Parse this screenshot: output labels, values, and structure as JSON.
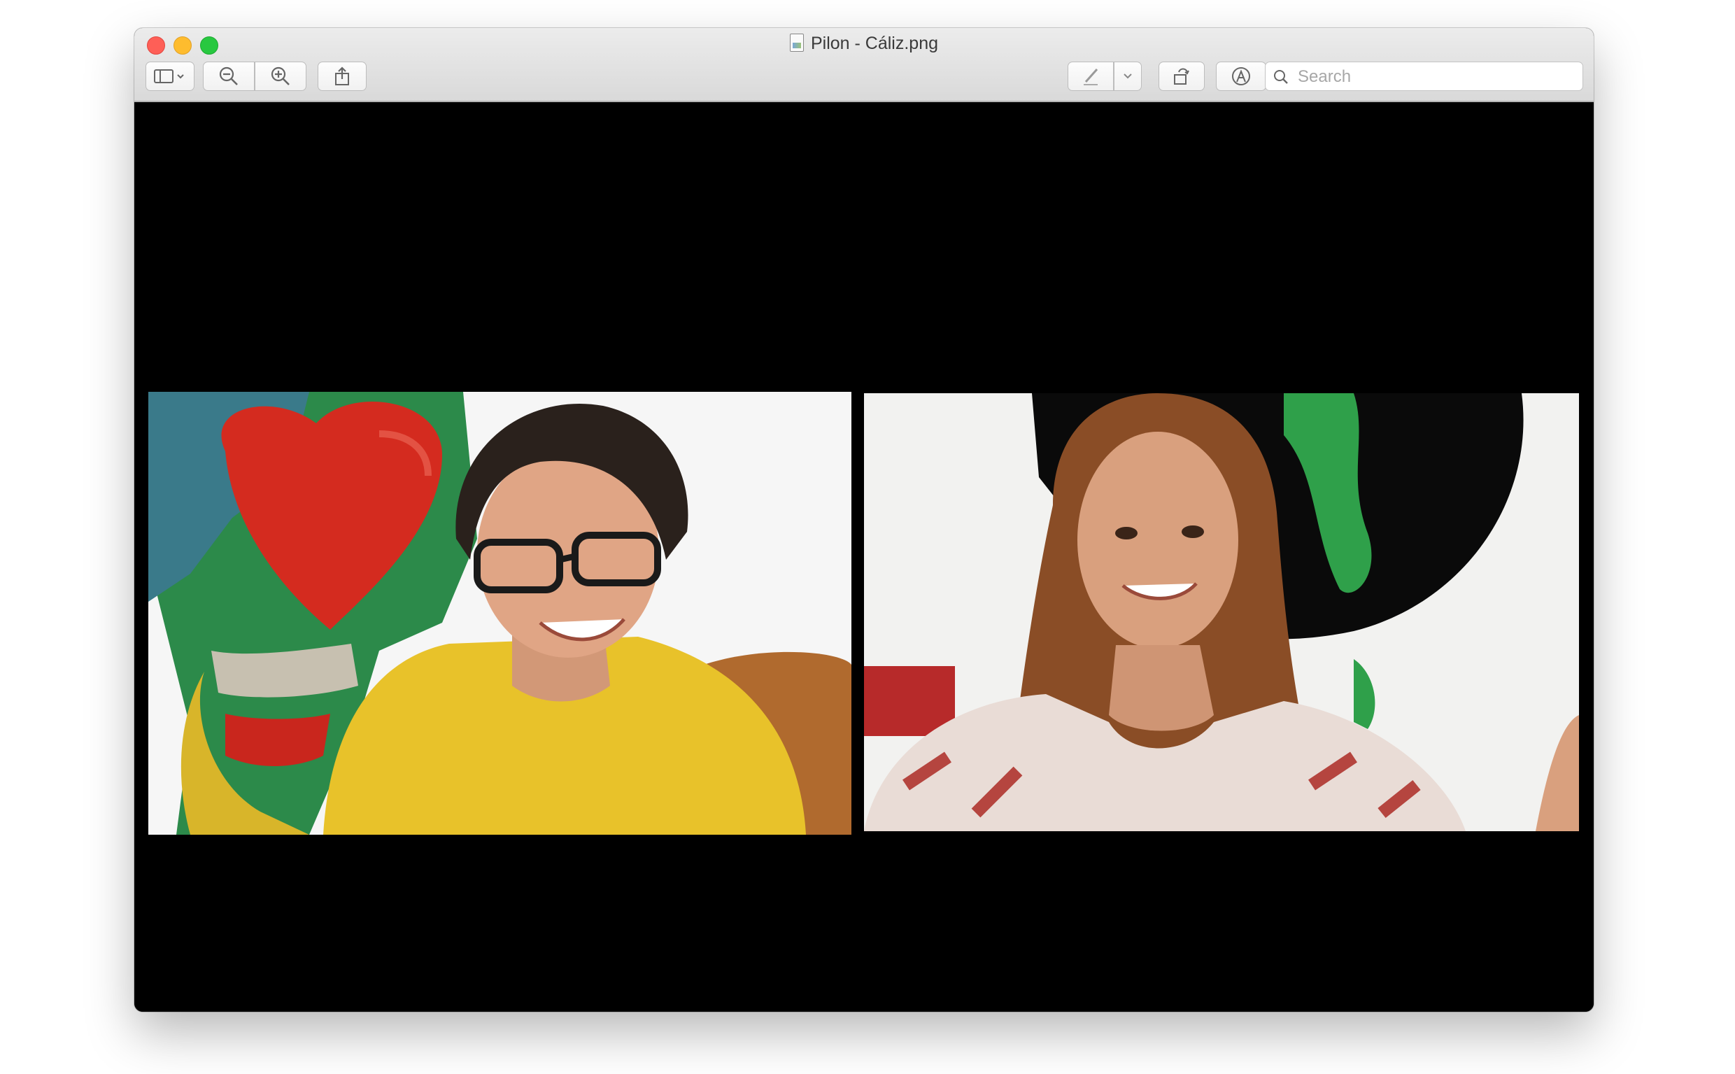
{
  "window": {
    "title": "Pilon - Cáliz.png",
    "traffic_lights": {
      "close": "#fe5f57",
      "minimize": "#febc2e",
      "maximize": "#28c840"
    }
  },
  "toolbar": {
    "sidebar_icon": "sidebar-icon",
    "zoom_out_icon": "zoom-out-icon",
    "zoom_in_icon": "zoom-in-icon",
    "share_icon": "share-icon",
    "markup_icon": "pen-icon",
    "rotate_icon": "rotate-icon",
    "annotate_icon": "markup-circle-icon",
    "search_placeholder": "Search"
  },
  "content": {
    "background": "#000000",
    "left_feed": {
      "main_colors": [
        "#e8c22a",
        "#d42b1f",
        "#2c8a4a"
      ]
    },
    "right_feed": {
      "main_colors": [
        "#b5453f",
        "#2fa04a",
        "#0a0a0a"
      ]
    }
  }
}
